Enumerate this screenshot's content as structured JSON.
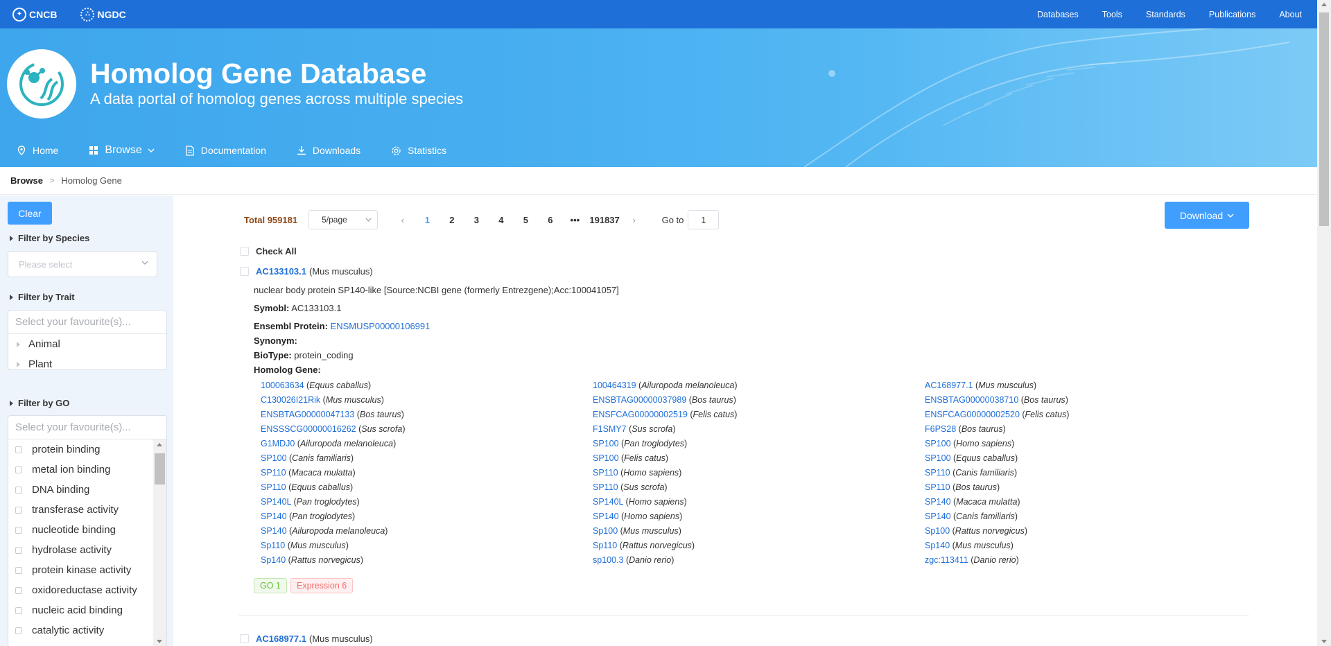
{
  "topbar": {
    "logo_cncb": "CNCB",
    "logo_ngdc": "NGDC",
    "nav": [
      "Databases",
      "Tools",
      "Standards",
      "Publications",
      "About"
    ]
  },
  "banner": {
    "title": "Homolog Gene Database",
    "subtitle": "A data portal of homolog genes across multiple species"
  },
  "menu": {
    "home": "Home",
    "browse": "Browse",
    "documentation": "Documentation",
    "downloads": "Downloads",
    "statistics": "Statistics"
  },
  "breadcrumb": {
    "root": "Browse",
    "current": "Homolog Gene"
  },
  "sidebar": {
    "clear": "Clear",
    "species_header": "Filter by Species",
    "species_placeholder": "Please select",
    "trait_header": "Filter by Trait",
    "trait_placeholder": "Select your favourite(s)...",
    "trait_items": [
      "Animal",
      "Plant"
    ],
    "go_header": "Filter by GO",
    "go_placeholder": "Select your favourite(s)...",
    "go_items": [
      "protein binding",
      "metal ion binding",
      "DNA binding",
      "transferase activity",
      "nucleotide binding",
      "hydrolase activity",
      "protein kinase activity",
      "oxidoreductase activity",
      "nucleic acid binding",
      "catalytic activity"
    ]
  },
  "pager": {
    "total": "Total 959181",
    "page_size": "5/page",
    "pages": [
      "1",
      "2",
      "3",
      "4",
      "5",
      "6"
    ],
    "ellipsis": "•••",
    "last": "191837",
    "goto_label": "Go to",
    "goto_value": "1"
  },
  "download": "Download",
  "check_all": "Check All",
  "record": {
    "id": "AC133103.1",
    "species": "(Mus musculus)",
    "description": "nuclear body protein SP140-like [Source:NCBI gene (formerly Entrezgene);Acc:100041057]",
    "symbol_label": "Symobl:",
    "symbol": "AC133103.1",
    "protein_label": "Ensembl Protein:",
    "protein": "ENSMUSP00000106991",
    "synonym_label": "Synonym:",
    "biotype_label": "BioType:",
    "biotype": "protein_coding",
    "homolog_label": "Homolog Gene:",
    "homologs": [
      {
        "g": "100063634",
        "s": "Equus caballus"
      },
      {
        "g": "100464319",
        "s": "Ailuropoda melanoleuca"
      },
      {
        "g": "AC168977.1",
        "s": "Mus musculus"
      },
      {
        "g": "C130026I21Rik",
        "s": "Mus musculus"
      },
      {
        "g": "ENSBTAG00000037989",
        "s": "Bos taurus"
      },
      {
        "g": "ENSBTAG00000038710",
        "s": "Bos taurus"
      },
      {
        "g": "ENSBTAG00000047133",
        "s": "Bos taurus"
      },
      {
        "g": "ENSFCAG00000002519",
        "s": "Felis catus"
      },
      {
        "g": "ENSFCAG00000002520",
        "s": "Felis catus"
      },
      {
        "g": "ENSSSCG00000016262",
        "s": "Sus scrofa"
      },
      {
        "g": "F1SMY7",
        "s": "Sus scrofa"
      },
      {
        "g": "F6PS28",
        "s": "Bos taurus"
      },
      {
        "g": "G1MDJ0",
        "s": "Ailuropoda melanoleuca"
      },
      {
        "g": "SP100",
        "s": "Pan troglodytes"
      },
      {
        "g": "SP100",
        "s": "Homo sapiens"
      },
      {
        "g": "SP100",
        "s": "Canis familiaris"
      },
      {
        "g": "SP100",
        "s": "Felis catus"
      },
      {
        "g": "SP100",
        "s": "Equus caballus"
      },
      {
        "g": "SP110",
        "s": "Macaca mulatta"
      },
      {
        "g": "SP110",
        "s": "Homo sapiens"
      },
      {
        "g": "SP110",
        "s": "Canis familiaris"
      },
      {
        "g": "SP110",
        "s": "Equus caballus"
      },
      {
        "g": "SP110",
        "s": "Sus scrofa"
      },
      {
        "g": "SP110",
        "s": "Bos taurus"
      },
      {
        "g": "SP140L",
        "s": "Pan troglodytes"
      },
      {
        "g": "SP140L",
        "s": "Homo sapiens"
      },
      {
        "g": "SP140",
        "s": "Macaca mulatta"
      },
      {
        "g": "SP140",
        "s": "Pan troglodytes"
      },
      {
        "g": "SP140",
        "s": "Homo sapiens"
      },
      {
        "g": "SP140",
        "s": "Canis familiaris"
      },
      {
        "g": "SP140",
        "s": "Ailuropoda melanoleuca"
      },
      {
        "g": "Sp100",
        "s": "Mus musculus"
      },
      {
        "g": "Sp100",
        "s": "Rattus norvegicus"
      },
      {
        "g": "Sp110",
        "s": "Mus musculus"
      },
      {
        "g": "Sp110",
        "s": "Rattus norvegicus"
      },
      {
        "g": "Sp140",
        "s": "Mus musculus"
      },
      {
        "g": "Sp140",
        "s": "Rattus norvegicus"
      },
      {
        "g": "sp100.3",
        "s": "Danio rerio"
      },
      {
        "g": "zgc:113411",
        "s": "Danio rerio"
      }
    ],
    "tag_go": "GO 1",
    "tag_expression": "Expression 6"
  },
  "record2": {
    "id": "AC168977.1",
    "species": "(Mus musculus)"
  },
  "colors": {
    "accent": "#409eff",
    "topbar": "#1e6fd8",
    "banner": "#47aef0",
    "link": "#1e6fd8"
  }
}
